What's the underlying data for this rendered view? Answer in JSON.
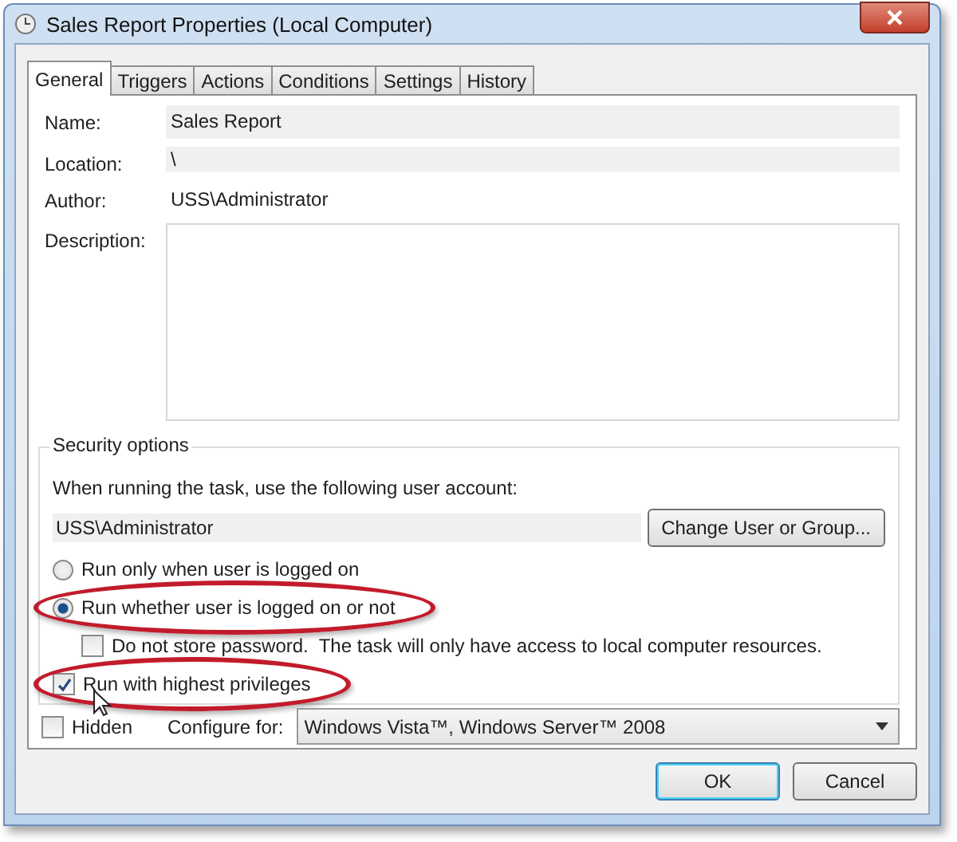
{
  "window": {
    "title": "Sales Report Properties (Local Computer)"
  },
  "tabs": [
    {
      "label": "General",
      "selected": true
    },
    {
      "label": "Triggers",
      "selected": false
    },
    {
      "label": "Actions",
      "selected": false
    },
    {
      "label": "Conditions",
      "selected": false
    },
    {
      "label": "Settings",
      "selected": false
    },
    {
      "label": "History",
      "selected": false
    }
  ],
  "fields": [
    {
      "label": "Name:",
      "value": "Sales Report",
      "kind": "field"
    },
    {
      "label": "Location:",
      "value": "\\",
      "kind": "field"
    },
    {
      "label": "Author:",
      "value": "USS\\Administrator",
      "kind": "plain"
    },
    {
      "label": "Description:",
      "kind": "area"
    }
  ],
  "security": {
    "title": "Security options",
    "account_prompt": "When running the task, use the following user account:",
    "account": "USS\\Administrator",
    "change_button": "Change User or Group...",
    "options": [
      {
        "kind": "radio",
        "label": "Run only when user is logged on",
        "selected": false,
        "highlighted": false
      },
      {
        "kind": "radio",
        "label": "Run whether user is logged on or not",
        "selected": true,
        "highlighted": true
      },
      {
        "kind": "subcheck",
        "label": "Do not store password.  The task will only have access to local computer resources.",
        "checked": false,
        "highlighted": false
      },
      {
        "kind": "check",
        "label": "Run with highest privileges",
        "checked": true,
        "highlighted": true
      }
    ]
  },
  "hidden": {
    "label": "Hidden",
    "checked": false
  },
  "configure": {
    "label": "Configure for:",
    "value": "Windows Vista™, Windows Server™ 2008"
  },
  "buttons": [
    {
      "label": "OK",
      "default": true
    },
    {
      "label": "Cancel",
      "default": false
    }
  ]
}
